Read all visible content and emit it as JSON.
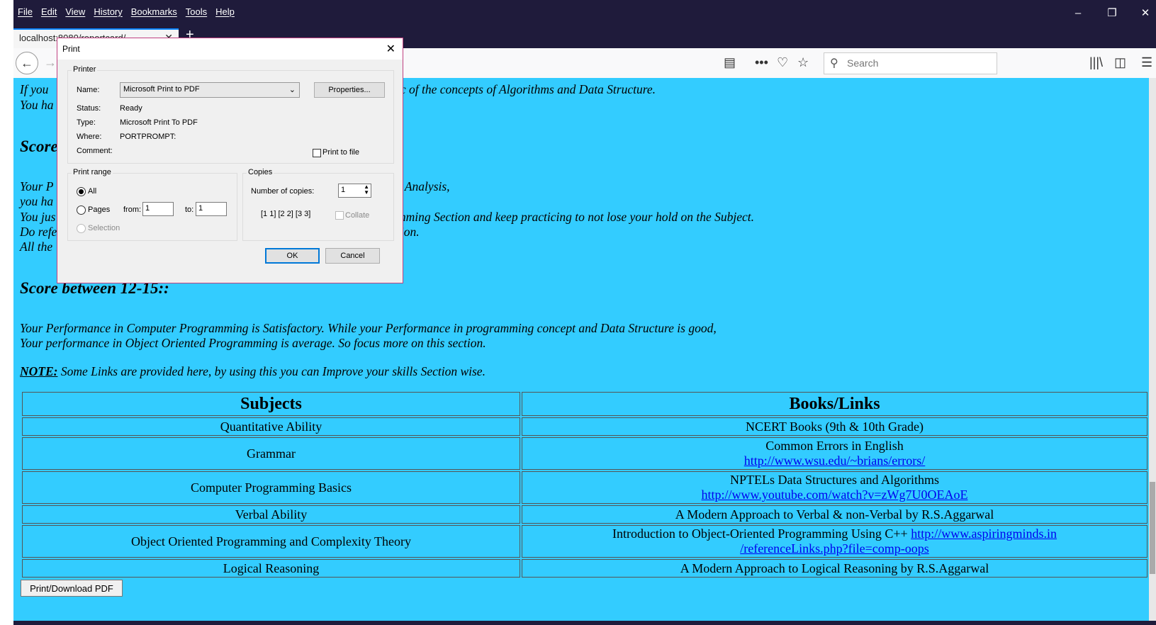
{
  "menu": [
    "File",
    "Edit",
    "View",
    "History",
    "Bookmarks",
    "Tools",
    "Help"
  ],
  "tab": {
    "title": "localhost:8080/reportcard/"
  },
  "toolbar": {
    "search_placeholder": "Search"
  },
  "content": {
    "line1": "If you are good in programming then only take the basic of the concepts of Algorithms and Data Structure.",
    "line1_visible": "ic of the concepts of Algorithms and Data Structure.",
    "line1_left": "If you",
    "line2_left": "You ha",
    "heading1_left": "Score",
    "line3_left": "Your P",
    "line3_right": "r Analysis,",
    "line4_left": "you ha",
    "line5_left": "You jus",
    "line5_right": "mming Section and keep practicing to not lose your hold on the Subject.",
    "line6_left": "Do refe",
    "line6_right": "tion.",
    "line7_left": "All the",
    "heading2": "Score between 12-15::",
    "para1": "Your Performance in Computer Programming is Satisfactory. While your Performance in programming concept and Data Structure is good,",
    "para2": "Your performance in Object Oriented Programming is average. So focus more on this section.",
    "note_label": "NOTE:",
    "note_text": " Some Links are provided here, by using this you can Improve your skills Section wise.",
    "table": {
      "headers": [
        "Subjects",
        "Books/Links"
      ],
      "rows": [
        {
          "subject": "Quantitative Ability",
          "book": "NCERT Books (9th & 10th Grade)",
          "link": ""
        },
        {
          "subject": "Grammar",
          "book": "Common Errors in English",
          "link": "http://www.wsu.edu/~brians/errors/"
        },
        {
          "subject": "Computer Programming Basics",
          "book": "NPTELs Data Structures and Algorithms",
          "link": "http://www.youtube.com/watch?v=zWg7U0OEAoE"
        },
        {
          "subject": "Verbal Ability",
          "book": "A Modern Approach to Verbal & non-Verbal by R.S.Aggarwal",
          "link": ""
        },
        {
          "subject": "Object Oriented Programming and Complexity Theory",
          "book": "Introduction to Object-Oriented Programming Using C++ ",
          "link": "http://www.aspiringminds.in",
          "link2": "/referenceLinks.php?file=comp-oops"
        },
        {
          "subject": "Logical Reasoning",
          "book": "A Modern Approach to Logical Reasoning by R.S.Aggarwal",
          "link": ""
        }
      ]
    },
    "print_button": "Print/Download PDF"
  },
  "dialog": {
    "title": "Print",
    "printer_group": "Printer",
    "name_label": "Name:",
    "name_value": "Microsoft Print to PDF",
    "properties_button": "Properties...",
    "status_label": "Status:",
    "status_value": "Ready",
    "type_label": "Type:",
    "type_value": "Microsoft Print To PDF",
    "where_label": "Where:",
    "where_value": "PORTPROMPT:",
    "comment_label": "Comment:",
    "print_to_file": "Print to file",
    "range_group": "Print range",
    "all": "All",
    "pages": "Pages",
    "from_label": "from:",
    "from_value": "1",
    "to_label": "to:",
    "to_value": "1",
    "selection": "Selection",
    "copies_group": "Copies",
    "num_copies_label": "Number of copies:",
    "num_copies_value": "1",
    "collate": "Collate",
    "ok": "OK",
    "cancel": "Cancel"
  }
}
